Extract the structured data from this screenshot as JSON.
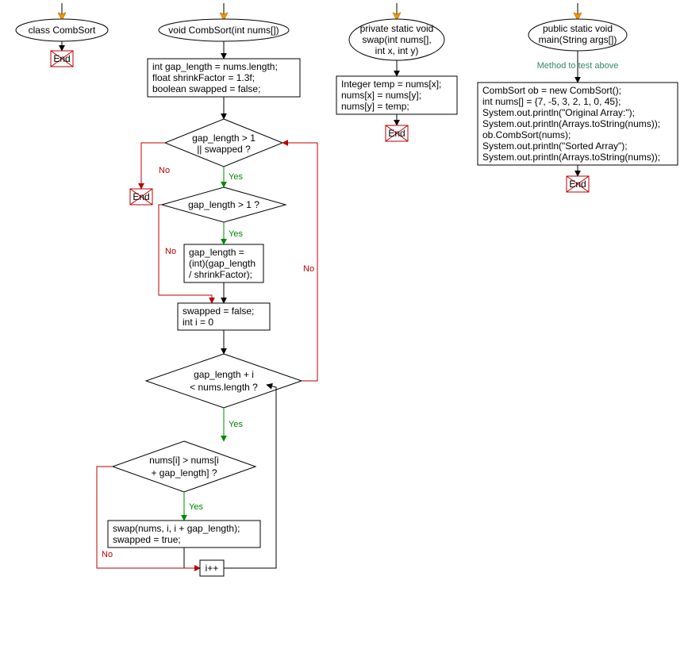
{
  "labels": {
    "yes": "Yes",
    "no": "No",
    "end": "End"
  },
  "col1": {
    "class_label": "class CombSort"
  },
  "col2": {
    "method": "void CombSort(int nums[])",
    "init_l1": "int gap_length = nums.length;",
    "init_l2": "float shrinkFactor = 1.3f;",
    "init_l3": "boolean swapped = false;",
    "cond1_l1": "gap_length > 1",
    "cond1_l2": "|| swapped ?",
    "cond2": "gap_length > 1 ?",
    "shrink_l1": "gap_length =",
    "shrink_l2": "(int)(gap_length",
    "shrink_l3": "/ shrinkFactor);",
    "reset_l1": "swapped = false;",
    "reset_l2": "int i = 0",
    "cond3_l1": "gap_length + i",
    "cond3_l2": "< nums.length ?",
    "cond4_l1": "nums[i] > nums[i",
    "cond4_l2": "+ gap_length] ?",
    "swap_l1": "swap(nums, i, i + gap_length);",
    "swap_l2": "swapped = true;",
    "inc": "i++"
  },
  "col3": {
    "method_l1": "private static void",
    "method_l2": "swap(int nums[],",
    "method_l3": "int x, int y)",
    "body_l1": "Integer temp = nums[x];",
    "body_l2": "nums[x] = nums[y];",
    "body_l3": "nums[y] = temp;"
  },
  "col4": {
    "method_l1": "public static void",
    "method_l2": "main(String args[])",
    "comment": "Method to test above",
    "body_l1": "CombSort ob = new CombSort();",
    "body_l2": "int nums[] = {7, -5, 3, 2, 1, 0, 45};",
    "body_l3": "System.out.println(\"Original Array:\");",
    "body_l4": "System.out.println(Arrays.toString(nums));",
    "body_l5": "ob.CombSort(nums);",
    "body_l6": "System.out.println(\"Sorted Array\");",
    "body_l7": "System.out.println(Arrays.toString(nums));"
  }
}
